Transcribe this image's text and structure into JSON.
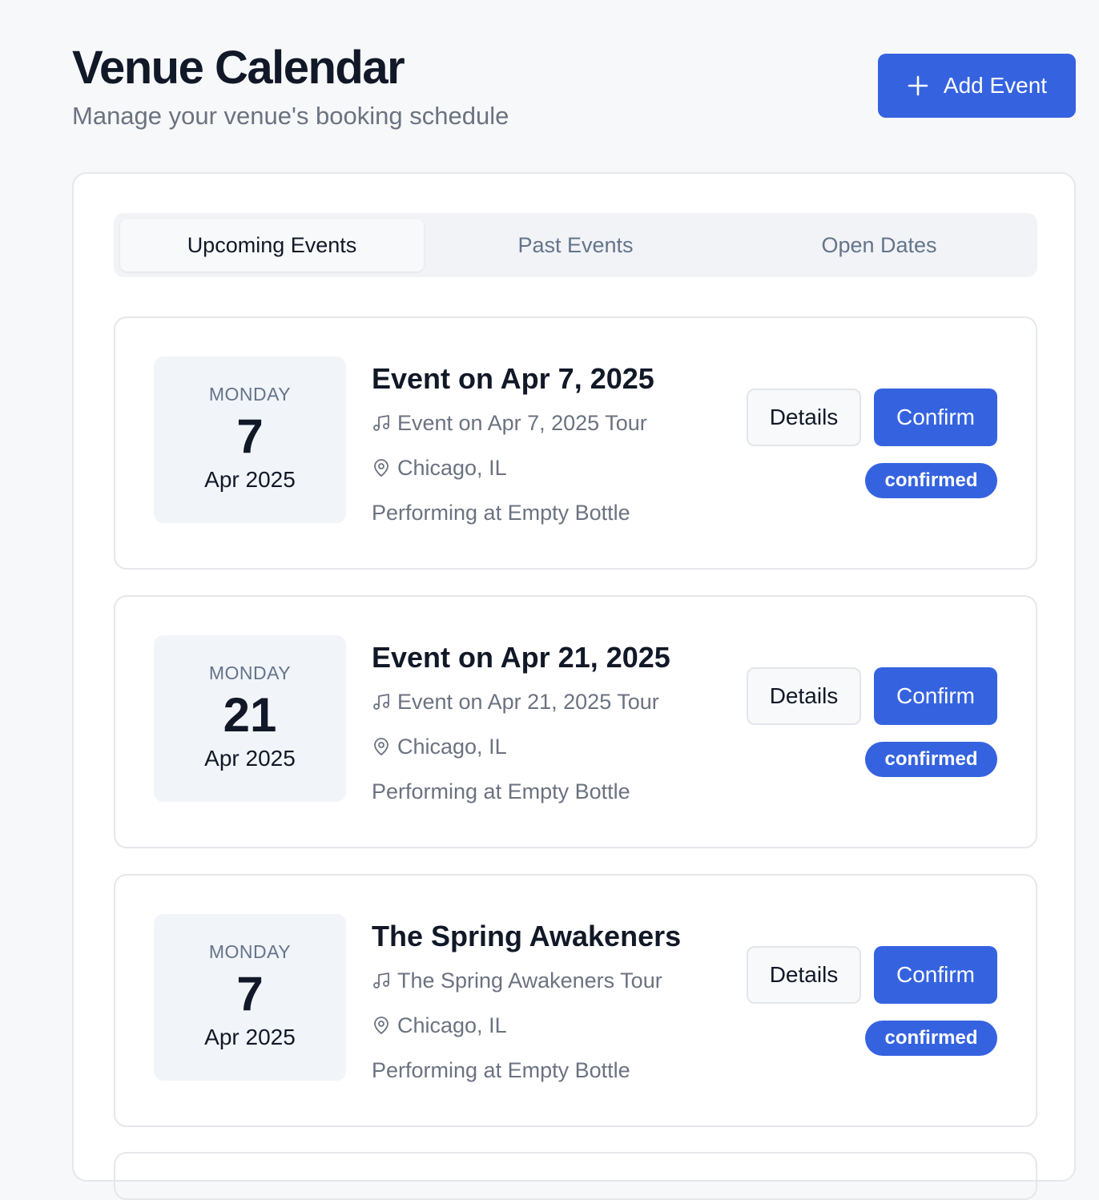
{
  "header": {
    "title": "Venue Calendar",
    "subtitle": "Manage your venue's booking schedule",
    "add_button_label": "Add Event",
    "add_button_icon": "plus-icon"
  },
  "tabs": [
    {
      "label": "Upcoming Events",
      "active": true
    },
    {
      "label": "Past Events",
      "active": false
    },
    {
      "label": "Open Dates",
      "active": false
    }
  ],
  "events": [
    {
      "weekday": "MONDAY",
      "day": "7",
      "month_year": "Apr 2025",
      "title": "Event on Apr 7, 2025",
      "tour": "Event on Apr 7, 2025 Tour",
      "location": "Chicago, IL",
      "performing": "Performing at Empty Bottle",
      "details_label": "Details",
      "confirm_label": "Confirm",
      "status": "confirmed"
    },
    {
      "weekday": "MONDAY",
      "day": "21",
      "month_year": "Apr 2025",
      "title": "Event on Apr 21, 2025",
      "tour": "Event on Apr 21, 2025 Tour",
      "location": "Chicago, IL",
      "performing": "Performing at Empty Bottle",
      "details_label": "Details",
      "confirm_label": "Confirm",
      "status": "confirmed"
    },
    {
      "weekday": "MONDAY",
      "day": "7",
      "month_year": "Apr 2025",
      "title": "The Spring Awakeners",
      "tour": "The Spring Awakeners Tour",
      "location": "Chicago, IL",
      "performing": "Performing at Empty Bottle",
      "details_label": "Details",
      "confirm_label": "Confirm",
      "status": "confirmed"
    }
  ],
  "colors": {
    "accent": "#3563e0",
    "background": "#f7f8fa",
    "muted_text": "#6b7280"
  }
}
